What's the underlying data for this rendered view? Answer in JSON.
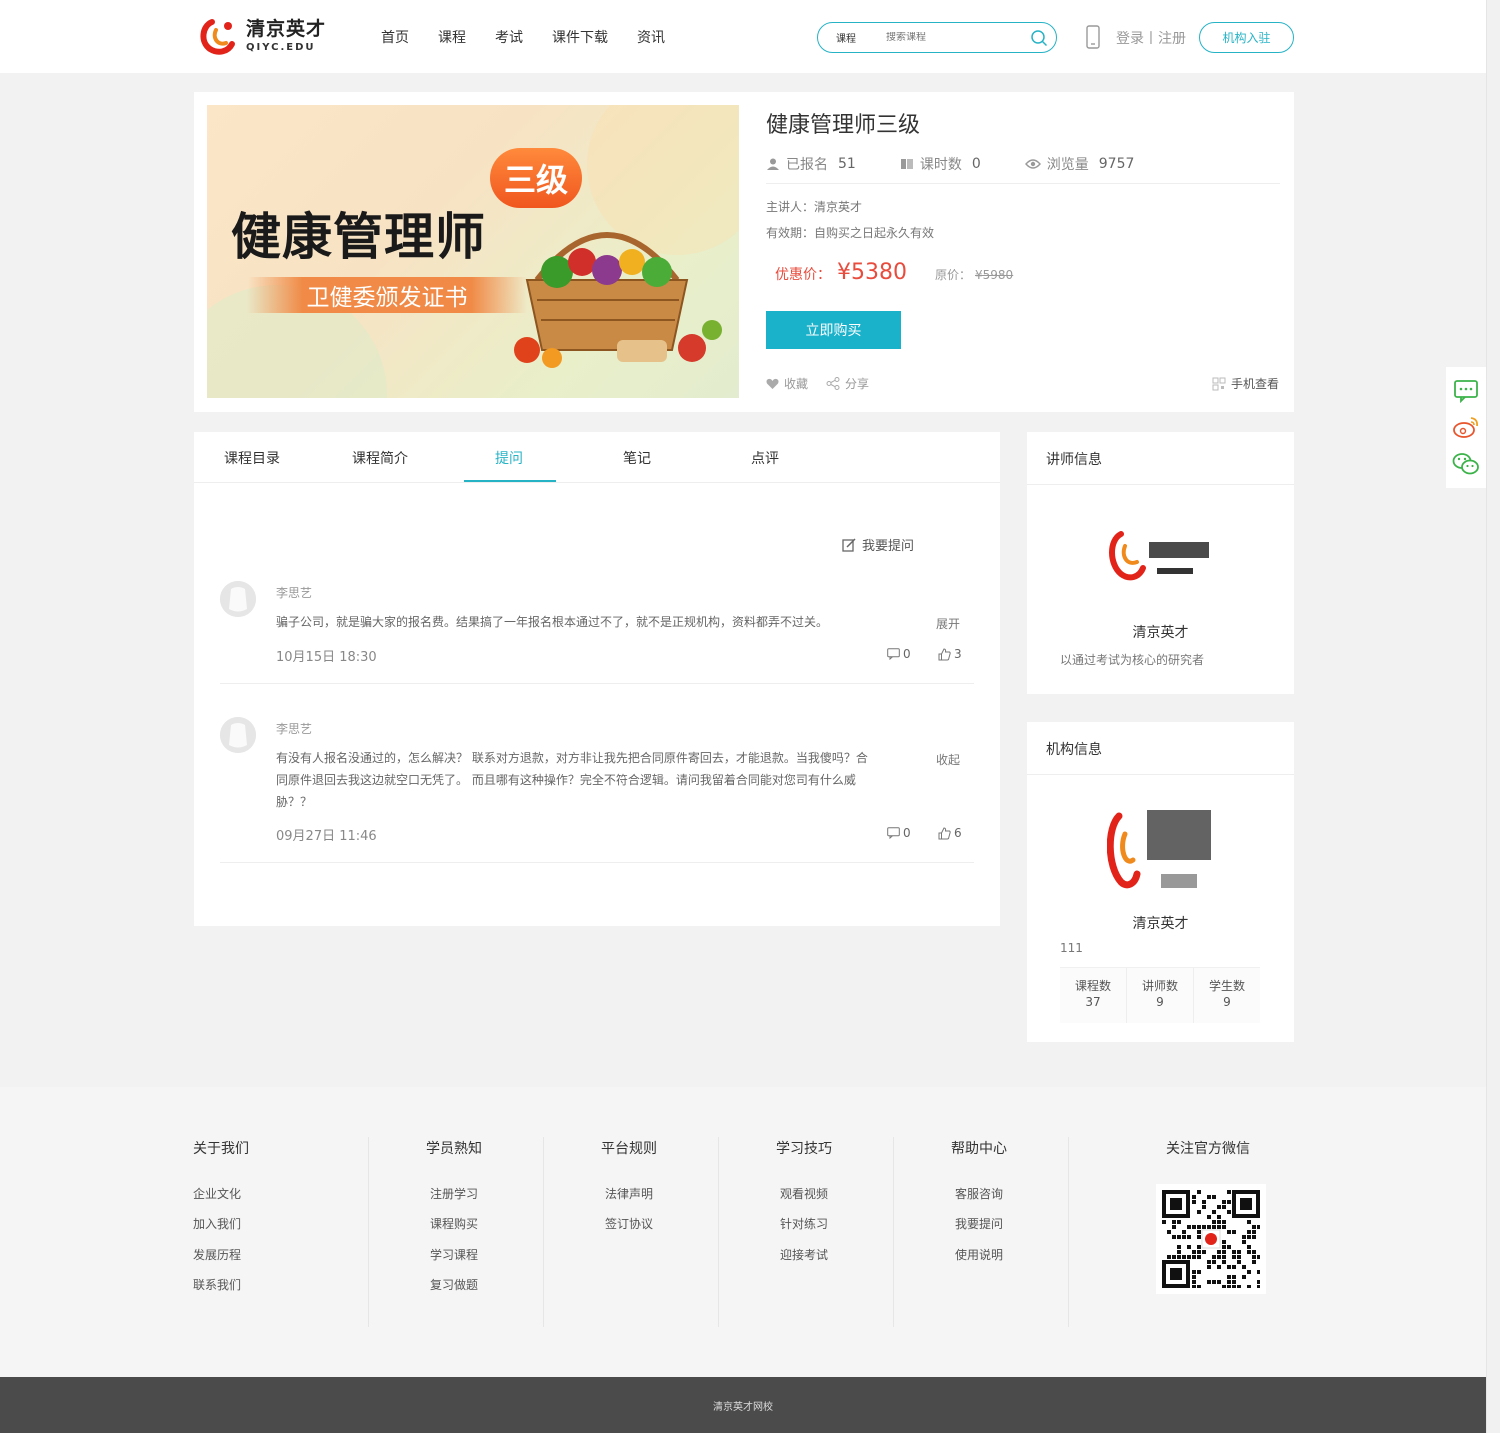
{
  "header": {
    "logo_cn": "清京英才",
    "logo_en": "QIYC.EDU",
    "nav": [
      "首页",
      "课程",
      "考试",
      "课件下载",
      "资讯"
    ],
    "search_category": "课程",
    "search_placeholder": "搜索课程",
    "login": "登录丨注册",
    "join": "机构入驻"
  },
  "course": {
    "banner_level": "三级",
    "banner_title": "健康管理师",
    "banner_sub": "卫健委颁发证书",
    "title": "健康管理师三级",
    "enrolled_label": "已报名",
    "enrolled": "51",
    "lessons_label": "课时数",
    "lessons": "0",
    "views_label": "浏览量",
    "views": "9757",
    "lecturer": "主讲人：清京英才",
    "validity": "有效期：自购买之日起永久有效",
    "price_label": "优惠价：",
    "price": "¥5380",
    "original_label": "原价：",
    "original_price": "¥5980",
    "buy": "立即购买",
    "favorite": "收藏",
    "share": "分享",
    "mobile_view": "手机查看"
  },
  "tabs": {
    "items": [
      "课程目录",
      "课程简介",
      "提问",
      "笔记",
      "点评"
    ],
    "active_index": 2
  },
  "questions": {
    "ask": "我要提问",
    "items": [
      {
        "name": "李思艺",
        "text": "骗子公司，就是骗大家的报名费。结果搞了一年报名根本通过不了，就不是正规机构，资料都弄不过关。",
        "toggle": "展开",
        "time": "10月15日 18:30",
        "comments": "0",
        "likes": "3"
      },
      {
        "name": "李思艺",
        "text": "有没有人报名没通过的，怎么解决？ 联系对方退款，对方非让我先把合同原件寄回去，才能退款。当我傻吗？合同原件退回去我这边就空口无凭了。 而且哪有这种操作？完全不符合逻辑。请问我留着合同能对您司有什么威胁？？",
        "toggle": "收起",
        "time": "09月27日 11:46",
        "comments": "0",
        "likes": "6"
      }
    ]
  },
  "teacher_card": {
    "header": "讲师信息",
    "name": "清京英才",
    "desc": "以通过考试为核心的研究者"
  },
  "org_card": {
    "header": "机构信息",
    "name": "清京英才",
    "desc": "111",
    "stats": [
      {
        "label": "课程数",
        "value": "37"
      },
      {
        "label": "讲师数",
        "value": "9"
      },
      {
        "label": "学生数",
        "value": "9"
      }
    ]
  },
  "footer": {
    "columns": [
      {
        "title": "关于我们",
        "links": [
          "企业文化",
          "加入我们",
          "发展历程",
          "联系我们"
        ]
      },
      {
        "title": "学员熟知",
        "links": [
          "注册学习",
          "课程购买",
          "学习课程",
          "复习做题"
        ]
      },
      {
        "title": "平台规则",
        "links": [
          "法律声明",
          "签订协议"
        ]
      },
      {
        "title": "学习技巧",
        "links": [
          "观看视频",
          "针对练习",
          "迎接考试"
        ]
      },
      {
        "title": "帮助中心",
        "links": [
          "客服咨询",
          "我要提问",
          "使用说明"
        ]
      }
    ],
    "wechat_title": "关注官方微信",
    "copyright": "清京英才网校"
  },
  "colors": {
    "accent": "#26b3c6",
    "price": "#e84c3d",
    "footer_bottom": "#4b4b4b"
  }
}
